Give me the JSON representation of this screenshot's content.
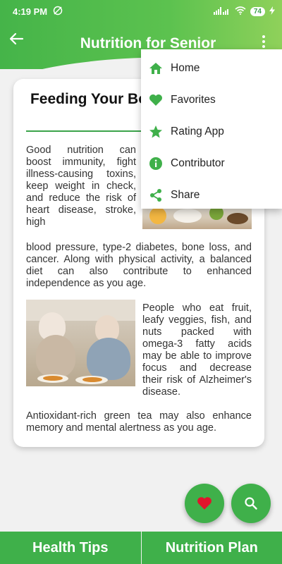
{
  "status_bar": {
    "time": "4:19 PM",
    "battery": "74"
  },
  "header": {
    "title": "Nutrition for Senior"
  },
  "article": {
    "title": "Feeding Your Body as You Age",
    "paragraph_1": "Good nutrition can boost immunity, fight illness-causing toxins, keep weight in check, and reduce the risk of heart disease, stroke, high",
    "paragraph_2": "blood pressure, type-2 diabetes, bone loss, and cancer. Along with physical activity, a balanced diet can also contribute to enhanced independence as you age.",
    "paragraph_3": "People who eat fruit, leafy veggies, fish, and nuts packed with omega-3 fatty acids may be able to improve focus and decrease their risk of Alzheimer's disease.",
    "paragraph_4": "Antioxidant-rich green tea may also enhance memory and mental alertness as you age."
  },
  "menu": {
    "items": [
      {
        "label": "Home",
        "icon": "home-icon"
      },
      {
        "label": "Favorites",
        "icon": "heart-icon"
      },
      {
        "label": "Rating App",
        "icon": "star-icon"
      },
      {
        "label": "Contributor",
        "icon": "info-icon"
      },
      {
        "label": "Share",
        "icon": "share-icon"
      }
    ]
  },
  "fabs": {
    "favorite_icon": "heart-icon",
    "search_icon": "search-icon"
  },
  "bottom_tabs": {
    "left": "Health Tips",
    "right": "Nutrition Plan"
  },
  "colors": {
    "accent": "#3fb04a",
    "favorite": "#e0142c"
  }
}
